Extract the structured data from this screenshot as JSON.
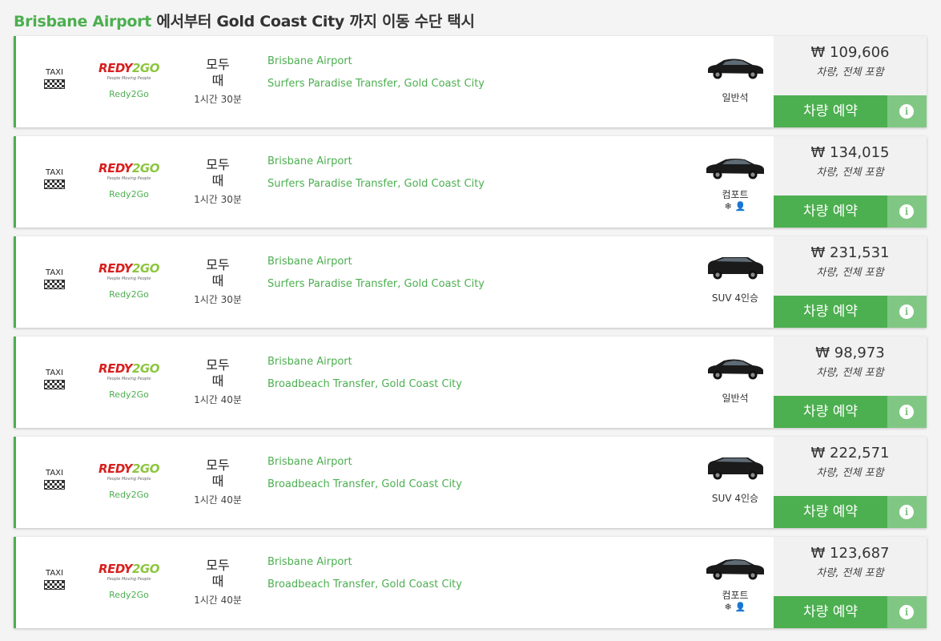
{
  "header": {
    "origin": "Brisbane Airport",
    "rest": " 에서부터 Gold Coast City 까지 이동 수단 택시"
  },
  "colors": {
    "accent": "#4caf50",
    "accent_light": "#81c784",
    "logo_red": "#d7201f",
    "logo_green": "#8cc63f"
  },
  "results": [
    {
      "type_label": "TAXI",
      "logo_a": "REDY",
      "logo_b": "2GO",
      "logo_tagline": "People Moving People",
      "company": "Redy2Go",
      "when": "모두 때",
      "duration": "1시간 30분",
      "from": "Brisbane Airport",
      "to": "Surfers Paradise Transfer, Gold Coast City",
      "vehicle_icon": "sedan-car-icon",
      "vehicle_class": "일반석",
      "amenities": [],
      "price": "₩ 109,606",
      "price_note": "차량, 전체 포함",
      "book_label": "차량 예약",
      "info_icon": "info-icon"
    },
    {
      "type_label": "TAXI",
      "logo_a": "REDY",
      "logo_b": "2GO",
      "logo_tagline": "People Moving People",
      "company": "Redy2Go",
      "when": "모두 때",
      "duration": "1시간 30분",
      "from": "Brisbane Airport",
      "to": "Surfers Paradise Transfer, Gold Coast City",
      "vehicle_icon": "luxury-sedan-icon",
      "vehicle_class": "컴포트",
      "amenities": [
        "❄",
        "👤"
      ],
      "price": "₩ 134,015",
      "price_note": "차량, 전체 포함",
      "book_label": "차량 예약",
      "info_icon": "info-icon"
    },
    {
      "type_label": "TAXI",
      "logo_a": "REDY",
      "logo_b": "2GO",
      "logo_tagline": "People Moving People",
      "company": "Redy2Go",
      "when": "모두 때",
      "duration": "1시간 30분",
      "from": "Brisbane Airport",
      "to": "Surfers Paradise Transfer, Gold Coast City",
      "vehicle_icon": "suv-icon",
      "vehicle_class": "SUV 4인승",
      "amenities": [],
      "price": "₩ 231,531",
      "price_note": "차량, 전체 포함",
      "book_label": "차량 예약",
      "info_icon": "info-icon"
    },
    {
      "type_label": "TAXI",
      "logo_a": "REDY",
      "logo_b": "2GO",
      "logo_tagline": "People Moving People",
      "company": "Redy2Go",
      "when": "모두 때",
      "duration": "1시간 40분",
      "from": "Brisbane Airport",
      "to": "Broadbeach Transfer, Gold Coast City",
      "vehicle_icon": "sedan-car-icon",
      "vehicle_class": "일반석",
      "amenities": [],
      "price": "₩ 98,973",
      "price_note": "차량, 전체 포함",
      "book_label": "차량 예약",
      "info_icon": "info-icon"
    },
    {
      "type_label": "TAXI",
      "logo_a": "REDY",
      "logo_b": "2GO",
      "logo_tagline": "People Moving People",
      "company": "Redy2Go",
      "when": "모두 때",
      "duration": "1시간 40분",
      "from": "Brisbane Airport",
      "to": "Broadbeach Transfer, Gold Coast City",
      "vehicle_icon": "suv-icon",
      "vehicle_class": "SUV 4인승",
      "amenities": [],
      "price": "₩ 222,571",
      "price_note": "차량, 전체 포함",
      "book_label": "차량 예약",
      "info_icon": "info-icon"
    },
    {
      "type_label": "TAXI",
      "logo_a": "REDY",
      "logo_b": "2GO",
      "logo_tagline": "People Moving People",
      "company": "Redy2Go",
      "when": "모두 때",
      "duration": "1시간 40분",
      "from": "Brisbane Airport",
      "to": "Broadbeach Transfer, Gold Coast City",
      "vehicle_icon": "luxury-sedan-icon",
      "vehicle_class": "컴포트",
      "amenities": [
        "❄",
        "👤"
      ],
      "price": "₩ 123,687",
      "price_note": "차량, 전체 포함",
      "book_label": "차량 예약",
      "info_icon": "info-icon"
    }
  ]
}
